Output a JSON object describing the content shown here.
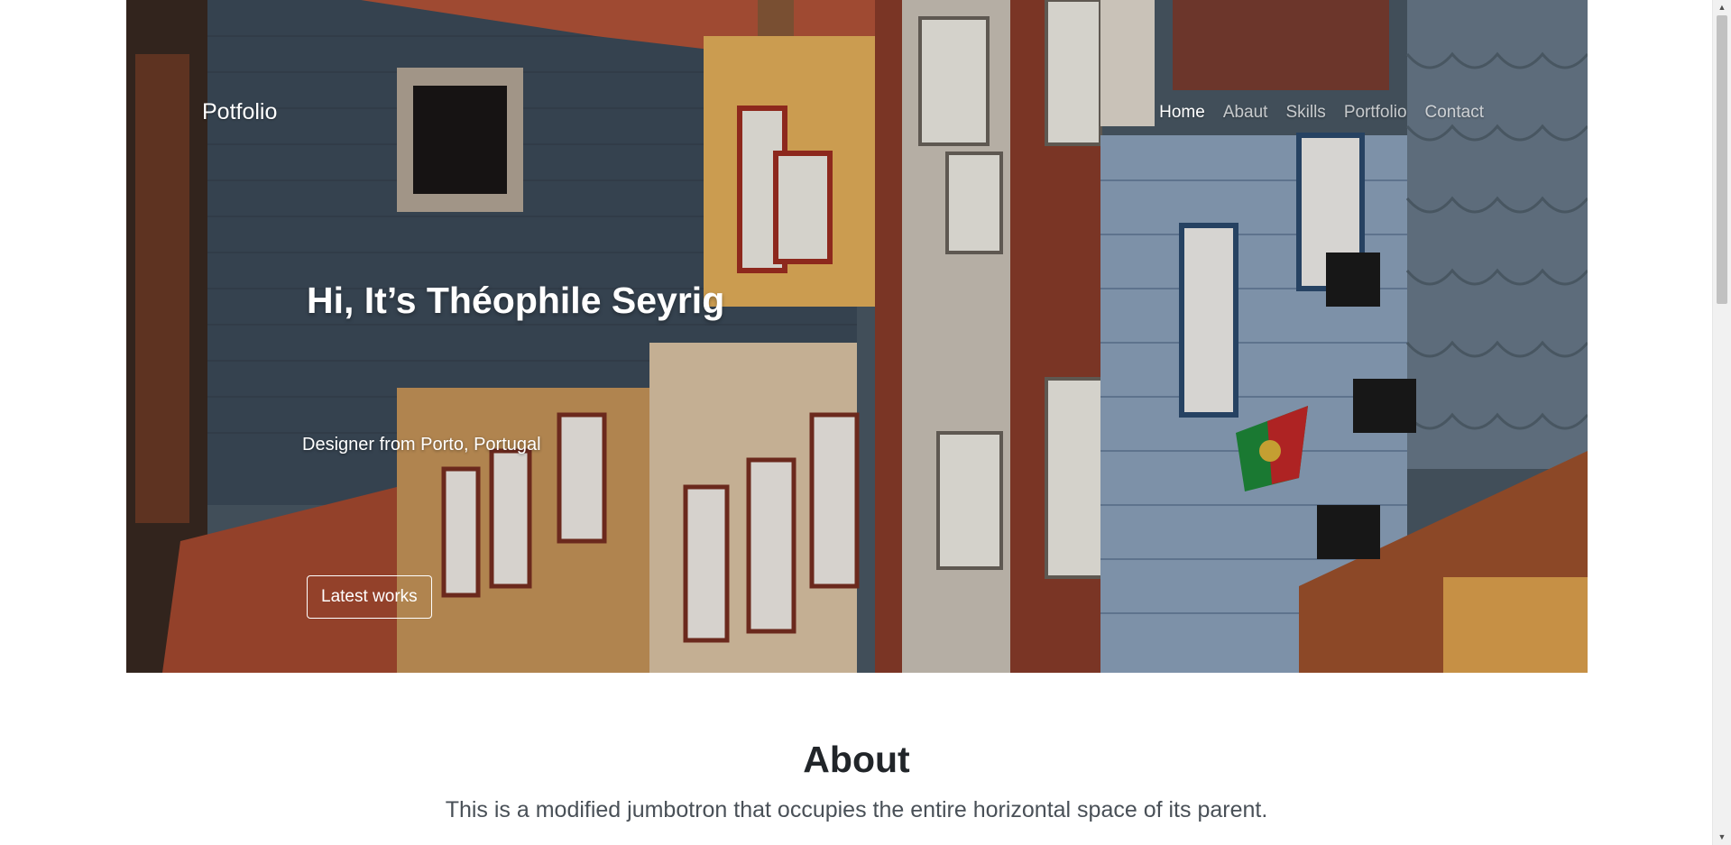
{
  "navbar": {
    "brand": "Potfolio",
    "items": [
      {
        "label": "Home",
        "active": true
      },
      {
        "label": "Abaut",
        "active": false
      },
      {
        "label": "Skills",
        "active": false
      },
      {
        "label": "Portfolio",
        "active": false
      },
      {
        "label": "Contact",
        "active": false
      }
    ]
  },
  "hero": {
    "title": "Hi, It’s Théophile Seyrig",
    "subtitle": "Designer from Porto, Portugal",
    "button_label": "Latest works"
  },
  "about": {
    "heading": "About",
    "text": "This is a modified jumbotron that occupies the entire horizontal space of its parent."
  },
  "scrollbar": {
    "up_icon": "▲",
    "down_icon": "▼"
  }
}
